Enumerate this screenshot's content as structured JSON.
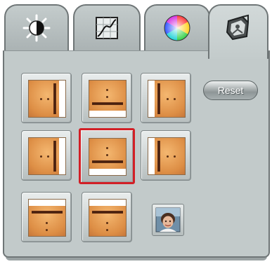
{
  "tabs": [
    {
      "icon": "brightness-contrast-icon",
      "selected": false
    },
    {
      "icon": "curves-graph-icon",
      "selected": false
    },
    {
      "icon": "color-wheel-icon",
      "selected": false
    },
    {
      "icon": "transform-photo-icon",
      "selected": true
    }
  ],
  "reset_button": {
    "label": "Reset"
  },
  "presets": {
    "selected_index": 4,
    "items": [
      {
        "id": "preset-1",
        "orientation": "right-bar"
      },
      {
        "id": "preset-2",
        "orientation": "bottom-bar"
      },
      {
        "id": "preset-3",
        "orientation": "left-bar"
      },
      {
        "id": "preset-4",
        "orientation": "right-bar"
      },
      {
        "id": "preset-5",
        "orientation": "bottom-bar"
      },
      {
        "id": "preset-6",
        "orientation": "left-bar"
      },
      {
        "id": "preset-7",
        "orientation": "top-bar"
      },
      {
        "id": "preset-8",
        "orientation": "top-bar"
      }
    ]
  },
  "colors": {
    "panel": "#c2caca",
    "selection_border": "#d21f26",
    "swatch": "#dd8e45"
  }
}
